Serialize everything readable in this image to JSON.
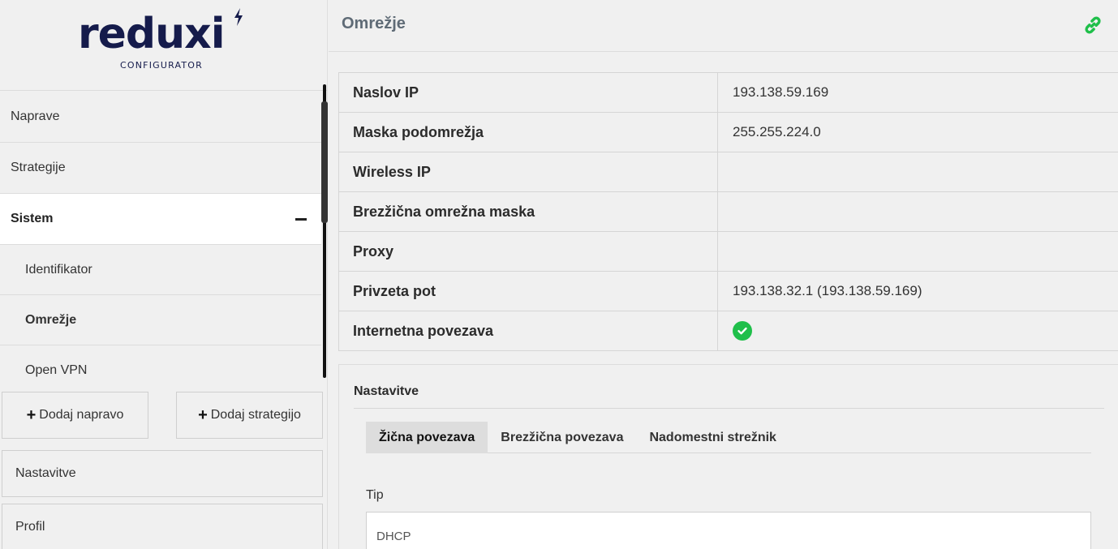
{
  "brand": {
    "logo_text": "reduxi",
    "logo_subtitle": "CONFIGURATOR"
  },
  "sidebar": {
    "items": [
      {
        "label": "Naprave"
      },
      {
        "label": "Strategije"
      },
      {
        "label": "Sistem",
        "expanded_icon": "minus-icon"
      },
      {
        "label": "Identifikator"
      },
      {
        "label": "Omrežje"
      },
      {
        "label": "Open VPN"
      }
    ],
    "buttons": {
      "add_device": "Dodaj napravo",
      "add_strategy": "Dodaj strategijo"
    },
    "bottom": {
      "settings": "Nastavitve",
      "profile": "Profil"
    }
  },
  "header": {
    "title": "Omrežje",
    "link_icon": "link-icon"
  },
  "network_info": {
    "rows": [
      {
        "label": "Naslov IP",
        "value": "193.138.59.169"
      },
      {
        "label": "Maska podomrežja",
        "value": "255.255.224.0"
      },
      {
        "label": "Wireless IP",
        "value": ""
      },
      {
        "label": "Brezžična omrežna maska",
        "value": ""
      },
      {
        "label": "Proxy",
        "value": ""
      },
      {
        "label": "Privzeta pot",
        "value": "193.138.32.1 (193.138.59.169)"
      },
      {
        "label": "Internetna povezava",
        "value_icon": "check-circle-icon"
      }
    ]
  },
  "settings": {
    "title": "Nastavitve",
    "tabs": [
      {
        "label": "Žična povezava",
        "active": true
      },
      {
        "label": "Brezžična povezava",
        "active": false
      },
      {
        "label": "Nadomestni strežnik",
        "active": false
      }
    ],
    "type_label": "Tip",
    "type_value": "DHCP"
  },
  "colors": {
    "brand": "#151b4b",
    "success": "#1fbf4a",
    "title_gray": "#5f6b76"
  }
}
